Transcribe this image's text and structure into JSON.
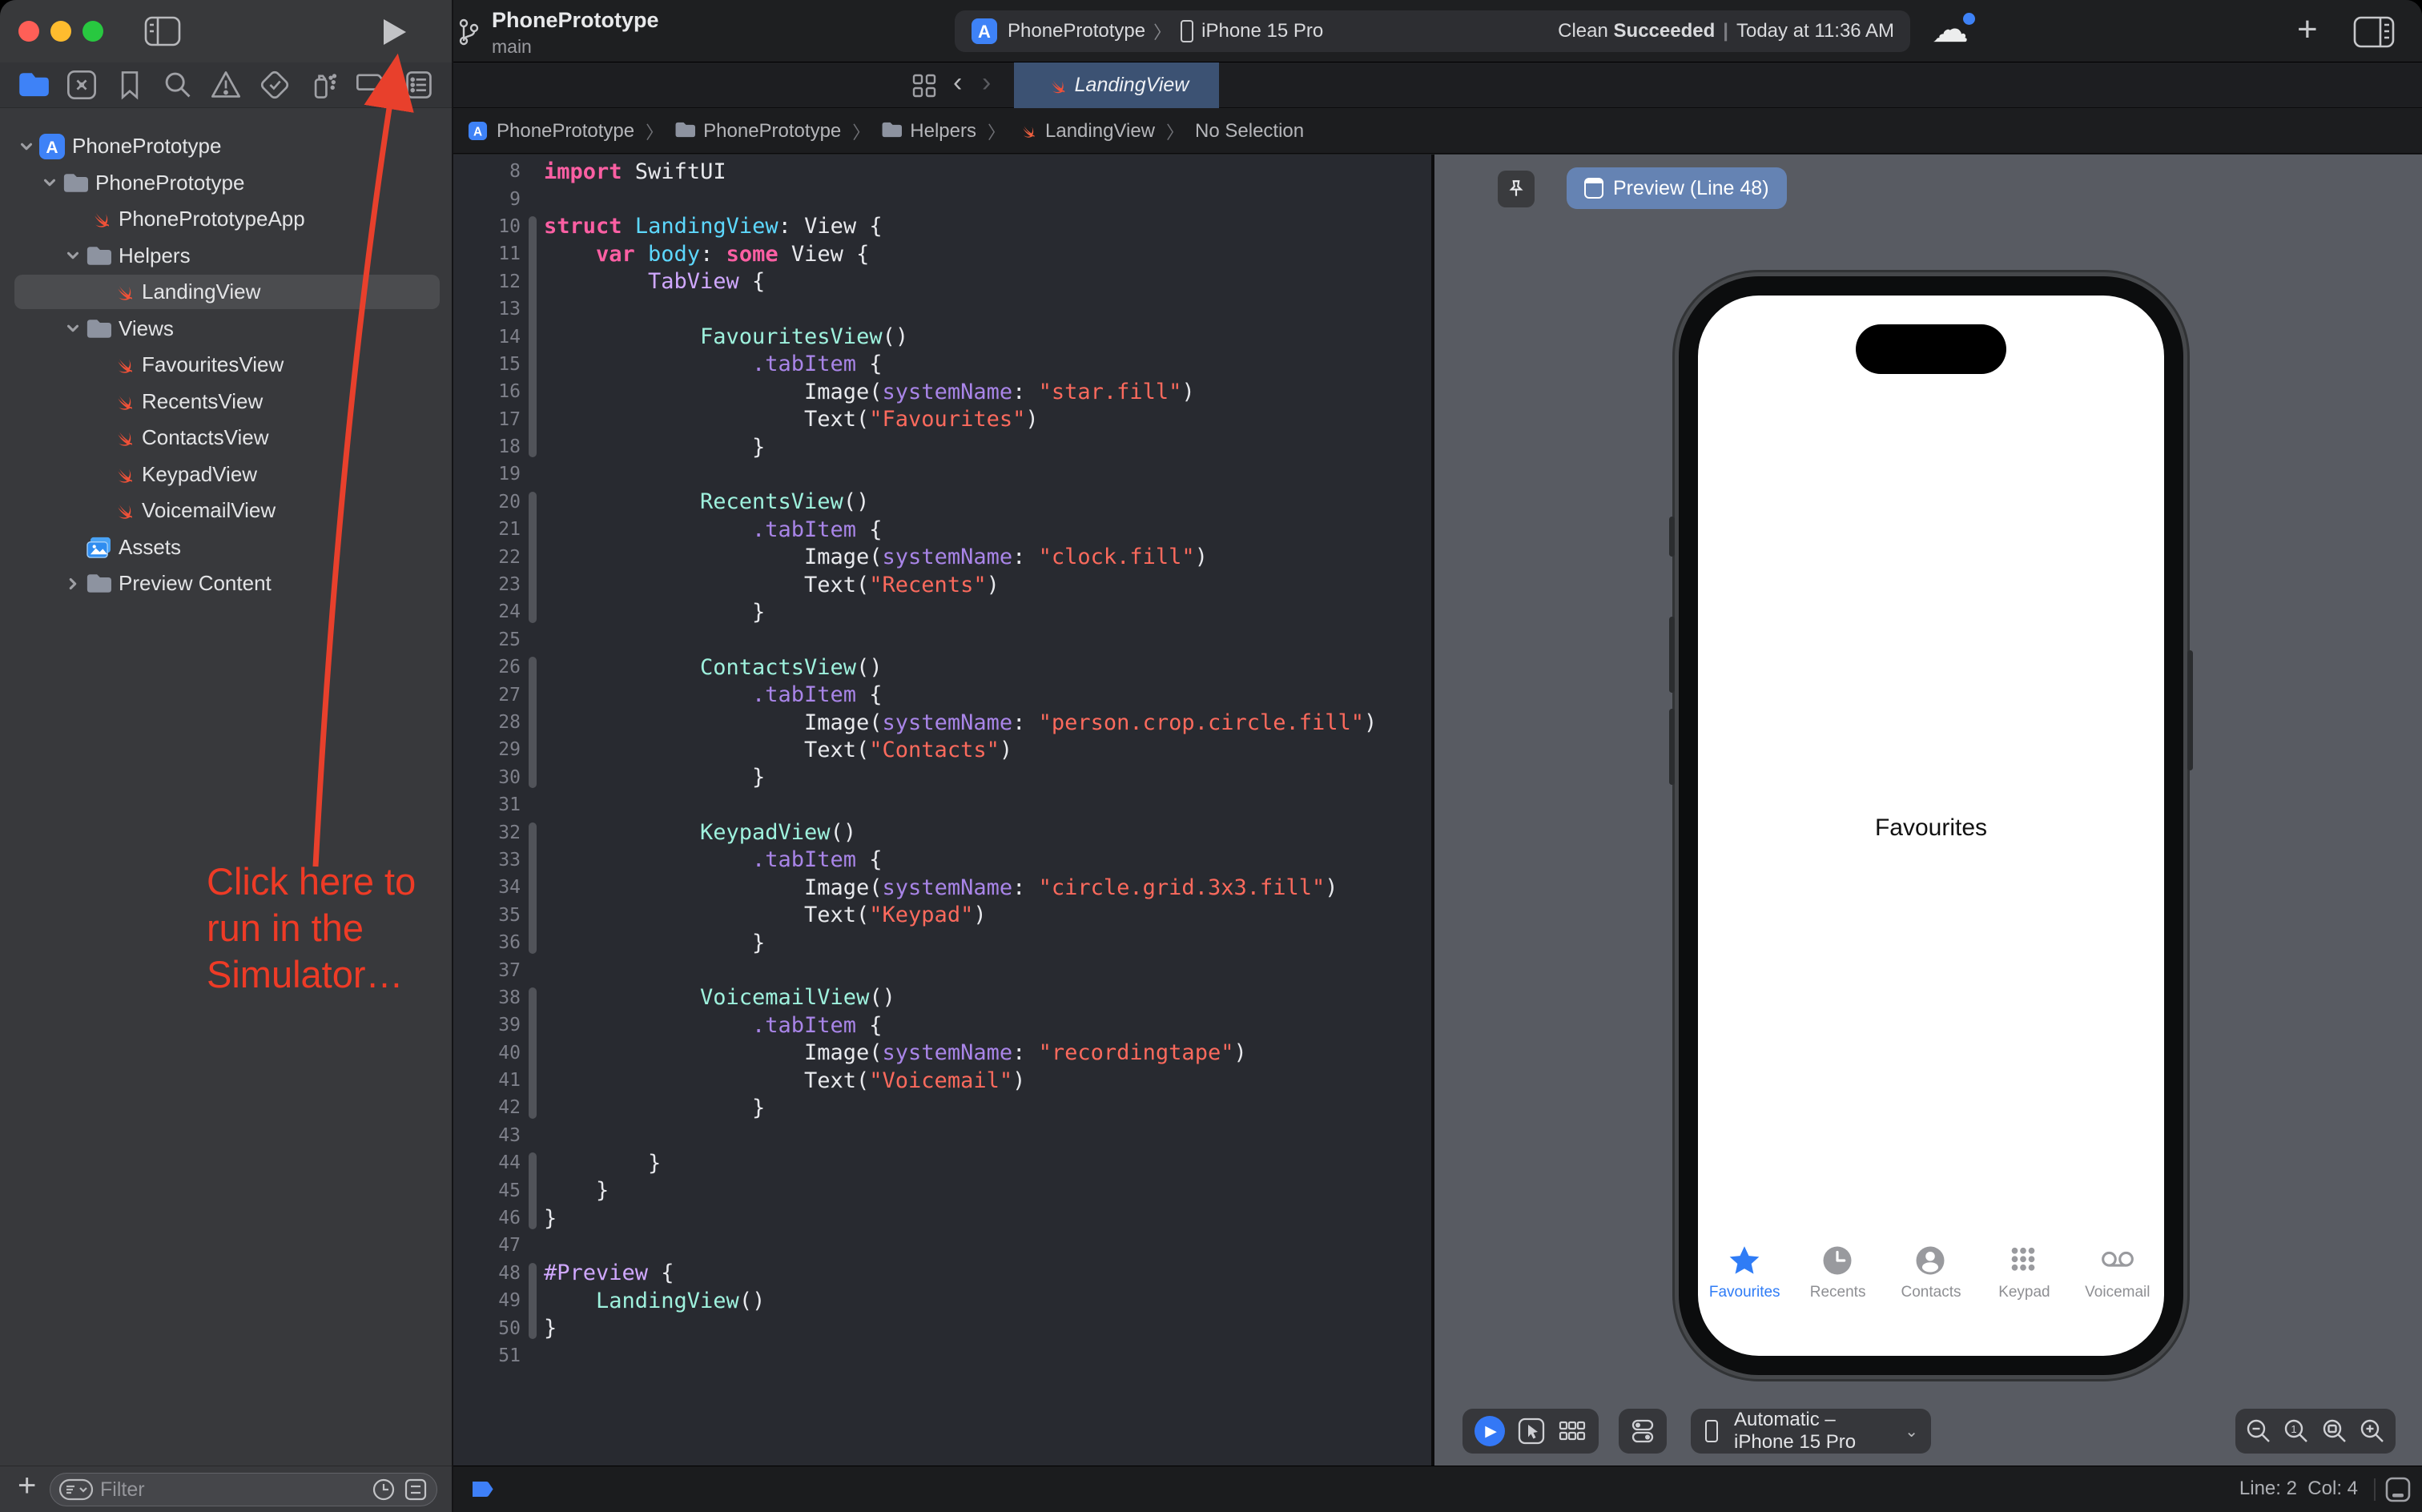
{
  "toolbar": {
    "project_title": "PhonePrototype",
    "branch": "main",
    "scheme_app": "PhonePrototype",
    "scheme_device": "iPhone 15 Pro",
    "status_action": "Clean",
    "status_result": "Succeeded",
    "status_time": "Today at 11:36 AM",
    "add_label": "+"
  },
  "tabstrip": {
    "active_tab": "LandingView",
    "back_chevron": "‹",
    "forward_chevron": "›"
  },
  "breadcrumb": [
    {
      "label": "PhonePrototype",
      "icon": "app"
    },
    {
      "label": "PhonePrototype",
      "icon": "folder"
    },
    {
      "label": "Helpers",
      "icon": "folder"
    },
    {
      "label": "LandingView",
      "icon": "swift"
    },
    {
      "label": "No Selection",
      "icon": "none"
    }
  ],
  "sidebar": {
    "tree": [
      {
        "label": "PhonePrototype",
        "icon": "project",
        "level": 0,
        "chevron": "down"
      },
      {
        "label": "PhonePrototype",
        "icon": "folder",
        "level": 1,
        "chevron": "down"
      },
      {
        "label": "PhonePrototypeApp",
        "icon": "swift",
        "level": 2,
        "chevron": "none"
      },
      {
        "label": "Helpers",
        "icon": "folder",
        "level": 2,
        "chevron": "down"
      },
      {
        "label": "LandingView",
        "icon": "swift",
        "level": 3,
        "chevron": "none",
        "selected": true
      },
      {
        "label": "Views",
        "icon": "folder",
        "level": 2,
        "chevron": "down"
      },
      {
        "label": "FavouritesView",
        "icon": "swift",
        "level": 3,
        "chevron": "none"
      },
      {
        "label": "RecentsView",
        "icon": "swift",
        "level": 3,
        "chevron": "none"
      },
      {
        "label": "ContactsView",
        "icon": "swift",
        "level": 3,
        "chevron": "none"
      },
      {
        "label": "KeypadView",
        "icon": "swift",
        "level": 3,
        "chevron": "none"
      },
      {
        "label": "VoicemailView",
        "icon": "swift",
        "level": 3,
        "chevron": "none"
      },
      {
        "label": "Assets",
        "icon": "assets",
        "level": 2,
        "chevron": "none"
      },
      {
        "label": "Preview Content",
        "icon": "folder",
        "level": 2,
        "chevron": "right"
      }
    ],
    "filter_placeholder": "Filter"
  },
  "code": {
    "lines": [
      {
        "n": 8,
        "i": 0,
        "t": [
          [
            "kw",
            "import"
          ],
          [
            "pl",
            " SwiftUI"
          ]
        ]
      },
      {
        "n": 9,
        "i": 0,
        "t": []
      },
      {
        "n": 10,
        "i": 0,
        "t": [
          [
            "kw",
            "struct"
          ],
          [
            "pl",
            " "
          ],
          [
            "decl",
            "LandingView"
          ],
          [
            "pl",
            ": View {"
          ]
        ]
      },
      {
        "n": 11,
        "i": 4,
        "t": [
          [
            "kw",
            "var"
          ],
          [
            "pl",
            " "
          ],
          [
            "decl",
            "body"
          ],
          [
            "pl",
            ": "
          ],
          [
            "kw",
            "some"
          ],
          [
            "pl",
            " View {"
          ]
        ]
      },
      {
        "n": 12,
        "i": 8,
        "t": [
          [
            "type",
            "TabView"
          ],
          [
            "pl",
            " {"
          ]
        ]
      },
      {
        "n": 13,
        "i": 0,
        "t": []
      },
      {
        "n": 14,
        "i": 12,
        "t": [
          [
            "mint",
            "FavouritesView"
          ],
          [
            "pl",
            "()"
          ]
        ]
      },
      {
        "n": 15,
        "i": 16,
        "t": [
          [
            "mem",
            ".tabItem"
          ],
          [
            "pl",
            " {"
          ]
        ]
      },
      {
        "n": 16,
        "i": 20,
        "t": [
          [
            "pl",
            "Image("
          ],
          [
            "mem",
            "systemName"
          ],
          [
            "pl",
            ": "
          ],
          [
            "str",
            "\"star.fill\""
          ],
          [
            "pl",
            ")"
          ]
        ]
      },
      {
        "n": 17,
        "i": 20,
        "t": [
          [
            "pl",
            "Text("
          ],
          [
            "str",
            "\"Favourites\""
          ],
          [
            "pl",
            ")"
          ]
        ]
      },
      {
        "n": 18,
        "i": 16,
        "t": [
          [
            "pl",
            "}"
          ]
        ]
      },
      {
        "n": 19,
        "i": 0,
        "t": []
      },
      {
        "n": 20,
        "i": 12,
        "t": [
          [
            "mint",
            "RecentsView"
          ],
          [
            "pl",
            "()"
          ]
        ]
      },
      {
        "n": 21,
        "i": 16,
        "t": [
          [
            "mem",
            ".tabItem"
          ],
          [
            "pl",
            " {"
          ]
        ]
      },
      {
        "n": 22,
        "i": 20,
        "t": [
          [
            "pl",
            "Image("
          ],
          [
            "mem",
            "systemName"
          ],
          [
            "pl",
            ": "
          ],
          [
            "str",
            "\"clock.fill\""
          ],
          [
            "pl",
            ")"
          ]
        ]
      },
      {
        "n": 23,
        "i": 20,
        "t": [
          [
            "pl",
            "Text("
          ],
          [
            "str",
            "\"Recents\""
          ],
          [
            "pl",
            ")"
          ]
        ]
      },
      {
        "n": 24,
        "i": 16,
        "t": [
          [
            "pl",
            "}"
          ]
        ]
      },
      {
        "n": 25,
        "i": 0,
        "t": []
      },
      {
        "n": 26,
        "i": 12,
        "t": [
          [
            "mint",
            "ContactsView"
          ],
          [
            "pl",
            "()"
          ]
        ]
      },
      {
        "n": 27,
        "i": 16,
        "t": [
          [
            "mem",
            ".tabItem"
          ],
          [
            "pl",
            " {"
          ]
        ]
      },
      {
        "n": 28,
        "i": 20,
        "t": [
          [
            "pl",
            "Image("
          ],
          [
            "mem",
            "systemName"
          ],
          [
            "pl",
            ": "
          ],
          [
            "str",
            "\"person.crop.circle.fill\""
          ],
          [
            "pl",
            ")"
          ]
        ]
      },
      {
        "n": 29,
        "i": 20,
        "t": [
          [
            "pl",
            "Text("
          ],
          [
            "str",
            "\"Contacts\""
          ],
          [
            "pl",
            ")"
          ]
        ]
      },
      {
        "n": 30,
        "i": 16,
        "t": [
          [
            "pl",
            "}"
          ]
        ]
      },
      {
        "n": 31,
        "i": 0,
        "t": []
      },
      {
        "n": 32,
        "i": 12,
        "t": [
          [
            "mint",
            "KeypadView"
          ],
          [
            "pl",
            "()"
          ]
        ]
      },
      {
        "n": 33,
        "i": 16,
        "t": [
          [
            "mem",
            ".tabItem"
          ],
          [
            "pl",
            " {"
          ]
        ]
      },
      {
        "n": 34,
        "i": 20,
        "t": [
          [
            "pl",
            "Image("
          ],
          [
            "mem",
            "systemName"
          ],
          [
            "pl",
            ": "
          ],
          [
            "str",
            "\"circle.grid.3x3.fill\""
          ],
          [
            "pl",
            ")"
          ]
        ]
      },
      {
        "n": 35,
        "i": 20,
        "t": [
          [
            "pl",
            "Text("
          ],
          [
            "str",
            "\"Keypad\""
          ],
          [
            "pl",
            ")"
          ]
        ]
      },
      {
        "n": 36,
        "i": 16,
        "t": [
          [
            "pl",
            "}"
          ]
        ]
      },
      {
        "n": 37,
        "i": 0,
        "t": []
      },
      {
        "n": 38,
        "i": 12,
        "t": [
          [
            "mint",
            "VoicemailView"
          ],
          [
            "pl",
            "()"
          ]
        ]
      },
      {
        "n": 39,
        "i": 16,
        "t": [
          [
            "mem",
            ".tabItem"
          ],
          [
            "pl",
            " {"
          ]
        ]
      },
      {
        "n": 40,
        "i": 20,
        "t": [
          [
            "pl",
            "Image("
          ],
          [
            "mem",
            "systemName"
          ],
          [
            "pl",
            ": "
          ],
          [
            "str",
            "\"recordingtape\""
          ],
          [
            "pl",
            ")"
          ]
        ]
      },
      {
        "n": 41,
        "i": 20,
        "t": [
          [
            "pl",
            "Text("
          ],
          [
            "str",
            "\"Voicemail\""
          ],
          [
            "pl",
            ")"
          ]
        ]
      },
      {
        "n": 42,
        "i": 16,
        "t": [
          [
            "pl",
            "}"
          ]
        ]
      },
      {
        "n": 43,
        "i": 0,
        "t": []
      },
      {
        "n": 44,
        "i": 8,
        "t": [
          [
            "pl",
            "}"
          ]
        ]
      },
      {
        "n": 45,
        "i": 4,
        "t": [
          [
            "pl",
            "}"
          ]
        ]
      },
      {
        "n": 46,
        "i": 0,
        "t": [
          [
            "pl",
            "}"
          ]
        ]
      },
      {
        "n": 47,
        "i": 0,
        "t": []
      },
      {
        "n": 48,
        "i": 0,
        "t": [
          [
            "type",
            "#Preview"
          ],
          [
            "pl",
            " {"
          ]
        ]
      },
      {
        "n": 49,
        "i": 4,
        "t": [
          [
            "mint",
            "LandingView"
          ],
          [
            "pl",
            "()"
          ]
        ]
      },
      {
        "n": 50,
        "i": 0,
        "t": [
          [
            "pl",
            "}"
          ]
        ]
      },
      {
        "n": 51,
        "i": 0,
        "t": []
      }
    ],
    "ribbons": [
      [
        10,
        18
      ],
      [
        20,
        24
      ],
      [
        26,
        30
      ],
      [
        32,
        36
      ],
      [
        38,
        42
      ],
      [
        44,
        46
      ],
      [
        48,
        50
      ]
    ]
  },
  "preview": {
    "pill_label": "Preview (Line 48)",
    "device_selector": "Automatic – iPhone 15 Pro",
    "device_chevron": "⌄",
    "phone": {
      "title": "Favourites",
      "tabs": [
        {
          "label": "Favourites",
          "icon": "star",
          "active": true
        },
        {
          "label": "Recents",
          "icon": "clock",
          "active": false
        },
        {
          "label": "Contacts",
          "icon": "person",
          "active": false
        },
        {
          "label": "Keypad",
          "icon": "keypad",
          "active": false
        },
        {
          "label": "Voicemail",
          "icon": "voicemail",
          "active": false
        }
      ]
    }
  },
  "statusbar": {
    "line_col": "Line: 2  Col: 4"
  },
  "annotation": {
    "lines": [
      "Click here to",
      "run in the",
      "Simulator…"
    ],
    "color": "#ee3b26"
  },
  "colors": {
    "accent_blue": "#3e82f7",
    "tab_active_bg": "#3c5273",
    "preview_pill_bg": "#6583b3",
    "canvas_bg": "#585b62",
    "editor_bg": "#282a30",
    "swift_orange": "#f05138",
    "annotation_red": "#ee3b26",
    "ios_tab_blue": "#2f7cf6"
  }
}
